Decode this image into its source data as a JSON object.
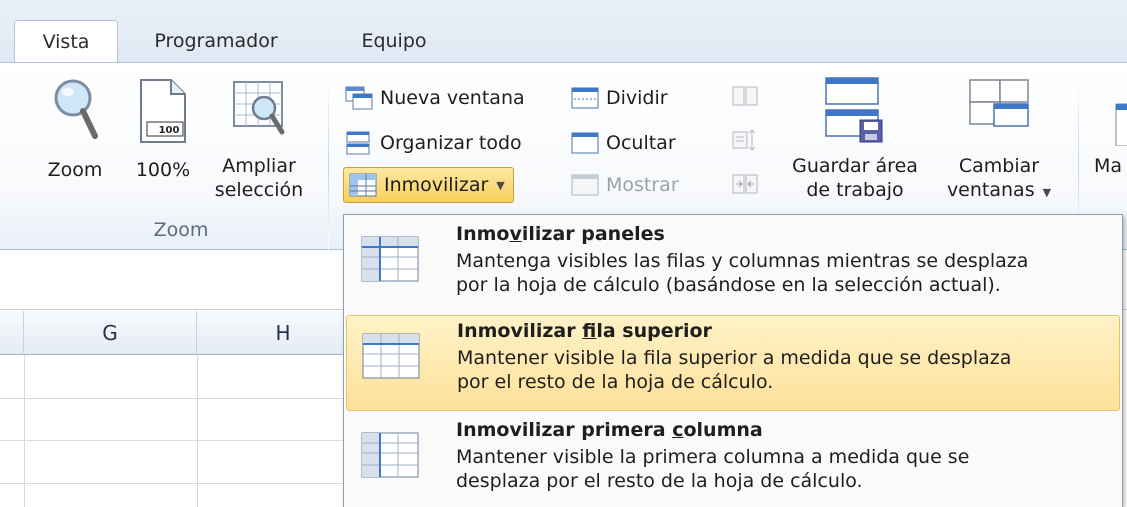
{
  "tabs": [
    {
      "label": "Vista",
      "active": true
    },
    {
      "label": "Programador",
      "active": false
    },
    {
      "label": "Equipo",
      "active": false
    }
  ],
  "zoom_group": {
    "label": "Zoom",
    "zoom_button": "Zoom",
    "hundred_button": "100%",
    "hundred_icon_text": "100",
    "ampliar_line1": "Ampliar",
    "ampliar_line2": "selección"
  },
  "window_group": {
    "nueva_ventana": "Nueva ventana",
    "organizar_todo": "Organizar todo",
    "inmovilizar": "Inmovilizar",
    "dividir": "Dividir",
    "ocultar": "Ocultar",
    "mostrar": "Mostrar",
    "guardar_line1": "Guardar área",
    "guardar_line2": "de trabajo",
    "cambiar_line1": "Cambiar",
    "cambiar_line2": "ventanas",
    "macros_partial": "Ma"
  },
  "columns": [
    "G",
    "H"
  ],
  "menu": {
    "items": [
      {
        "title_pre": "Inmo",
        "title_key": "v",
        "title_post": "ilizar paneles",
        "desc_line1": "Mantenga visibles las filas y columnas mientras se desplaza",
        "desc_line2": "por la hoja de cálculo (basándose en la selección actual).",
        "highlighted": false
      },
      {
        "title_pre": "Inmovilizar ",
        "title_key": "f",
        "title_post": "ila superior",
        "desc_line1": "Mantener visible la fila superior a medida que se desplaza",
        "desc_line2": "por el resto de la hoja de cálculo.",
        "highlighted": true
      },
      {
        "title_pre": "Inmovilizar primera ",
        "title_key": "c",
        "title_post": "olumna",
        "desc_line1": "Mantener visible la primera columna a medida que se",
        "desc_line2": "desplaza por el resto de la hoja de cálculo.",
        "highlighted": false
      }
    ]
  },
  "icons": [
    "magnifier-icon",
    "page-100-icon",
    "zoom-selection-icon",
    "new-window-icon",
    "arrange-all-icon",
    "freeze-panes-icon",
    "split-icon",
    "hide-icon",
    "unhide-icon",
    "side-by-side-icon",
    "sync-scroll-icon",
    "reset-position-icon",
    "save-workspace-icon",
    "switch-windows-icon",
    "macros-icon",
    "freeze-panes-menu-icon",
    "freeze-top-row-icon",
    "freeze-first-column-icon"
  ],
  "colors": {
    "accent_highlight": "#fde19a",
    "ribbon_border": "#a9bcd5",
    "tab_strip": "#dfe8f3"
  }
}
